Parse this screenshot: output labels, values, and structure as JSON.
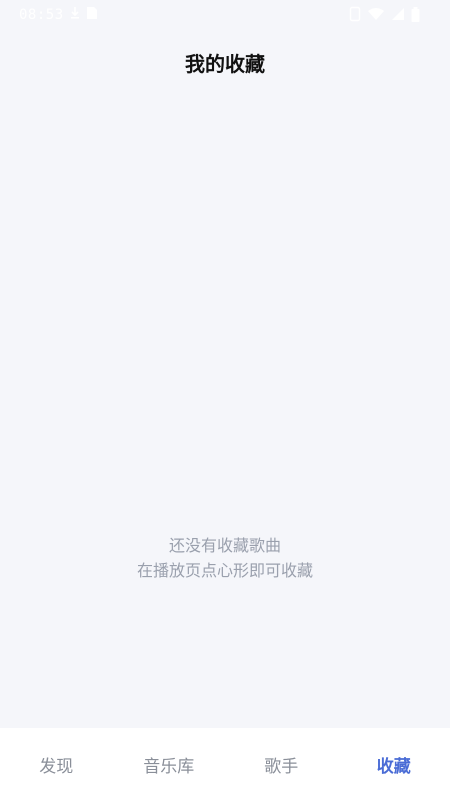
{
  "status_bar": {
    "time": "08:53",
    "icons": [
      "download-icon",
      "sim-card-icon",
      "phone-icon",
      "wifi-icon",
      "cellular-signal-icon",
      "battery-icon"
    ]
  },
  "header": {
    "title": "我的收藏"
  },
  "empty_state": {
    "line1": "还没有收藏歌曲",
    "line2": "在播放页点心形即可收藏"
  },
  "tab_bar": {
    "tabs": [
      {
        "label": "发现",
        "active": false
      },
      {
        "label": "音乐库",
        "active": false
      },
      {
        "label": "歌手",
        "active": false
      },
      {
        "label": "收藏",
        "active": true
      }
    ],
    "active_color": "#4a6cd6",
    "inactive_color": "#8a8f99"
  },
  "colors": {
    "background": "#f5f6fa",
    "tab_bar_background": "#ffffff"
  }
}
